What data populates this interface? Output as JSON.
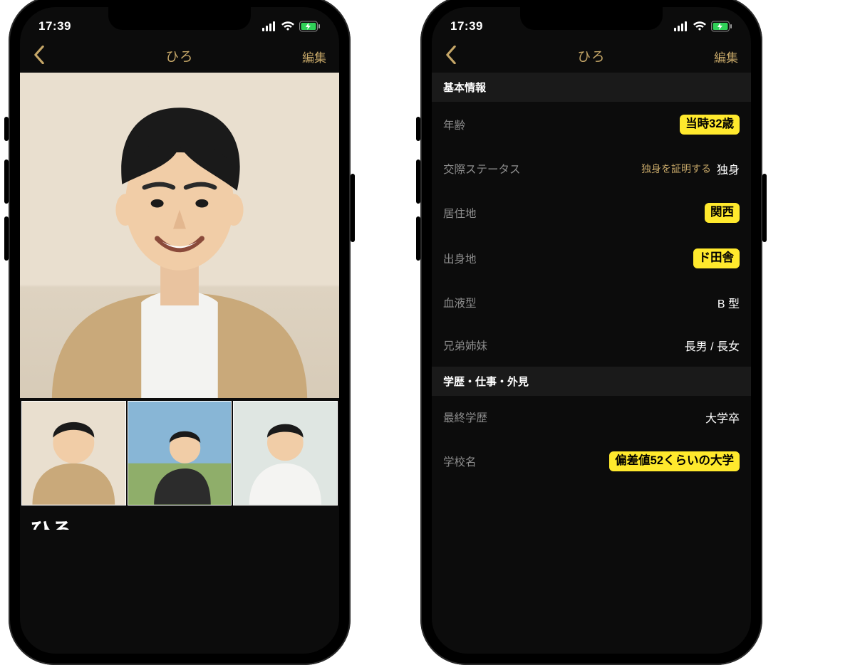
{
  "status": {
    "time": "17:39"
  },
  "nav": {
    "title": "ひろ",
    "edit": "編集"
  },
  "left": {
    "name_preview": "ひろ"
  },
  "right": {
    "sections": {
      "basic_header": "基本情報",
      "edu_header": "学歴・仕事・外見"
    },
    "rows": {
      "age": {
        "label": "年齢",
        "value": "当時32歳",
        "highlight": true
      },
      "relstat": {
        "label": "交際ステータス",
        "verify": "独身を証明する",
        "value": "独身"
      },
      "residence": {
        "label": "居住地",
        "value": "関西",
        "highlight": true
      },
      "hometown": {
        "label": "出身地",
        "value": "ド田舎",
        "highlight": true
      },
      "blood": {
        "label": "血液型",
        "value": "B 型"
      },
      "siblings": {
        "label": "兄弟姉妹",
        "value": "長男 / 長女"
      },
      "edu": {
        "label": "最終学歴",
        "value": "大学卒"
      },
      "school": {
        "label": "学校名",
        "value": "偏差値52くらいの大学",
        "highlight": true
      }
    }
  }
}
